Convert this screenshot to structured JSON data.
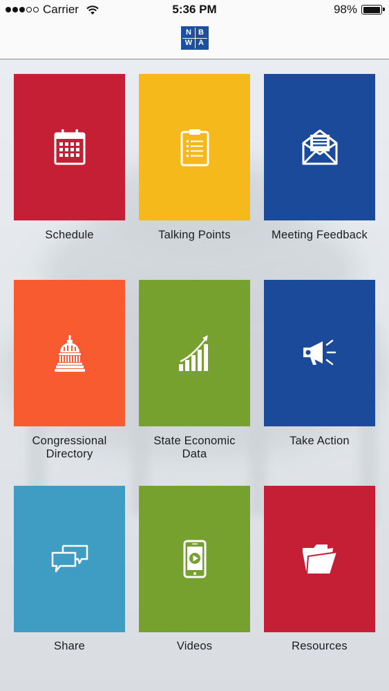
{
  "status_bar": {
    "carrier": "Carrier",
    "time": "5:36 PM",
    "battery": "98%",
    "battery_level": 0.98,
    "signal_bars": 3
  },
  "app": {
    "logo_letters": [
      "N",
      "B",
      "W",
      "A"
    ]
  },
  "menu": {
    "items": [
      {
        "label": "Schedule",
        "icon": "calendar-icon",
        "color": "#c41f34"
      },
      {
        "label": "Talking Points",
        "icon": "clipboard-icon",
        "color": "#f5b91c"
      },
      {
        "label": "Meeting Feedback",
        "icon": "envelope-icon",
        "color": "#1b4a9a"
      },
      {
        "label": "Congressional\nDirectory",
        "icon": "capitol-dome-icon",
        "color": "#f75b2f"
      },
      {
        "label": "State Economic\nData",
        "icon": "growth-chart-icon",
        "color": "#76a12e"
      },
      {
        "label": "Take Action",
        "icon": "megaphone-icon",
        "color": "#1b4a9a"
      },
      {
        "label": "Share",
        "icon": "chat-bubbles-icon",
        "color": "#3f9dc4"
      },
      {
        "label": "Videos",
        "icon": "phone-video-icon",
        "color": "#76a12e"
      },
      {
        "label": "Resources",
        "icon": "folder-icon",
        "color": "#c41f34"
      }
    ]
  }
}
